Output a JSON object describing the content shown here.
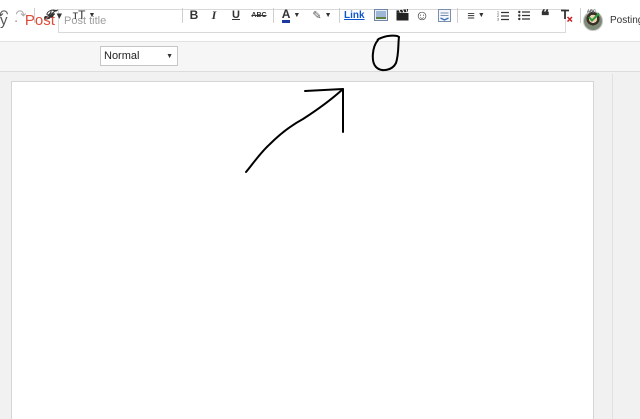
{
  "header": {
    "brand_prefix": "y",
    "brand_separator": "·",
    "brand_section": "Post",
    "title_placeholder": "Post title",
    "status": "Posting"
  },
  "toolbar": {
    "undo": "↶",
    "redo": "↷",
    "font_family": "𝓕",
    "font_size": "ᴛT",
    "format_select": "Normal",
    "bold": "B",
    "italic": "I",
    "underline": "U",
    "strikethrough": "ABC",
    "text_color": "A",
    "highlight": "✎",
    "link": "Link",
    "image": "image-icon",
    "video": "video-icon",
    "emoji": "☺",
    "jump_break": "jump-break-icon",
    "align": "≡",
    "numbered_list": "numbered-list-icon",
    "bulleted_list": "bulleted-list-icon",
    "quote": "❝",
    "clear_format": "Tx",
    "spellcheck": "ABC"
  },
  "colors": {
    "brand_accent": "#dd4b39",
    "link": "#1155cc",
    "annotation": "#000000",
    "spellcheck": "#2e9e3a",
    "clear_format_x": "#cc2222"
  }
}
